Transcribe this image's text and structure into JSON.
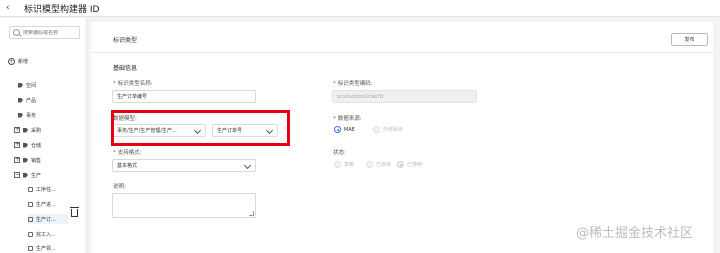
{
  "app": {
    "back_glyph": "‹",
    "title": "标识模型构建器 ID"
  },
  "sidebar": {
    "search_placeholder": "搜索编码或名称",
    "add_label": "新增",
    "items": [
      {
        "label": "空间",
        "icon": "tag-icon"
      },
      {
        "label": "产品",
        "icon": "tag-icon"
      },
      {
        "label": "事务",
        "icon": "tag-icon"
      },
      {
        "label": "采购",
        "icon": "expand-icon",
        "glyph": "+"
      },
      {
        "label": "仓储",
        "icon": "expand-icon",
        "glyph": "+"
      },
      {
        "label": "销售",
        "icon": "expand-icon",
        "glyph": "+"
      },
      {
        "label": "生产",
        "icon": "collapse-icon",
        "glyph": "−"
      },
      {
        "label": "工序任...",
        "icon": "leaf-icon"
      },
      {
        "label": "生产进...",
        "icon": "leaf-icon"
      },
      {
        "label": "生产订...",
        "icon": "leaf-icon",
        "selected": true
      },
      {
        "label": "完工入...",
        "icon": "leaf-icon"
      },
      {
        "label": "生产领...",
        "icon": "leaf-icon"
      }
    ]
  },
  "main": {
    "title": "标识类型",
    "publish_label": "发布",
    "section_title": "基础信息",
    "type_name": {
      "label": "标识类型名称:",
      "value": "生产订单编号"
    },
    "type_code": {
      "label": "标识类型编码:",
      "value": "productionOrderID"
    },
    "data_model": {
      "label": "数据模型:",
      "path_value": "事务/生产/生产管理/生产...",
      "entity_value": "生产订单号"
    },
    "data_source": {
      "label": "数据来源:",
      "options": [
        "MAE",
        "外部系统"
      ],
      "selected": "MAE"
    },
    "support_format": {
      "label": "支持格式:",
      "value": "基本格式"
    },
    "status": {
      "label": "状态:",
      "options": [
        "草稿",
        "已启用",
        "已停用"
      ],
      "selected": "已停用"
    },
    "description": {
      "label": "说明:",
      "value": ""
    }
  },
  "watermark": "@稀土掘金技术社区",
  "colors": {
    "accent": "#3370ff",
    "highlight": "#e60012",
    "required": "#e4393c"
  }
}
